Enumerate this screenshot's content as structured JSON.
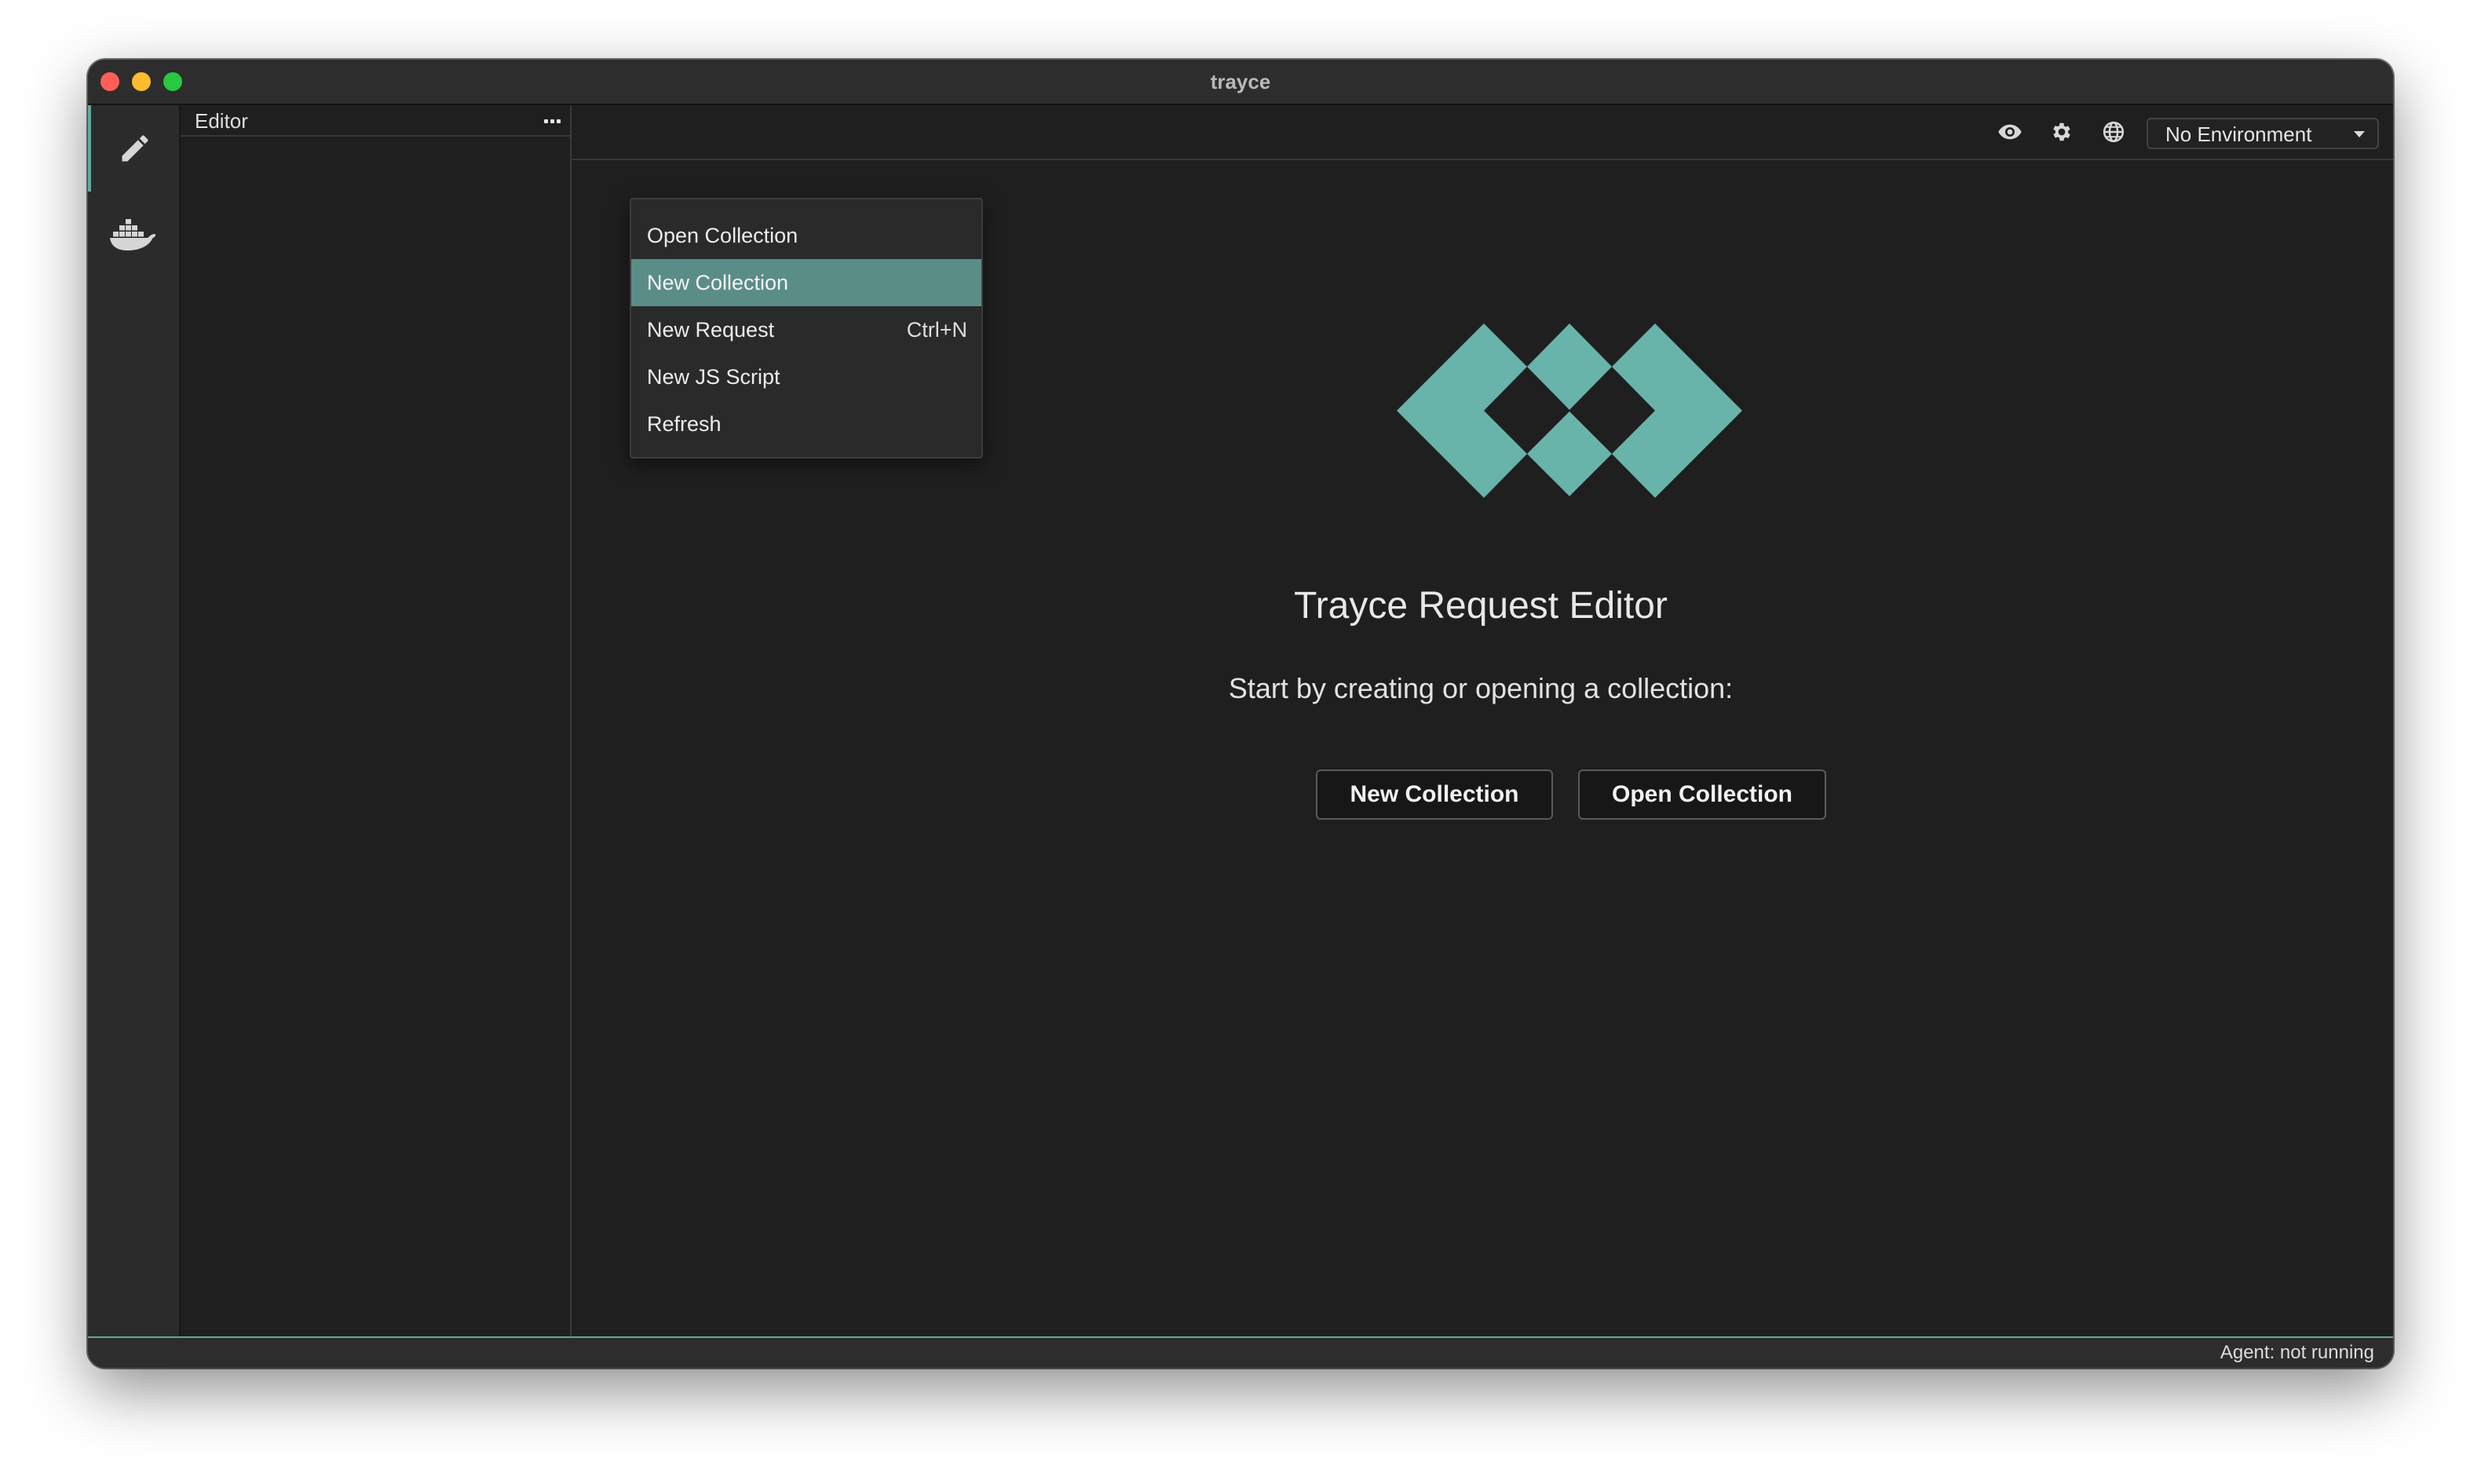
{
  "window": {
    "title": "trayce"
  },
  "activity_bar": {
    "items": [
      {
        "icon": "pencil-icon",
        "active": true
      },
      {
        "icon": "docker-whale-icon",
        "active": false
      }
    ]
  },
  "sidebar": {
    "title": "Editor",
    "more_icon": "more-horizontal-icon"
  },
  "menu": {
    "items": [
      {
        "label": "Open Collection",
        "shortcut": ""
      },
      {
        "label": "New Collection",
        "shortcut": "",
        "highlighted": true
      },
      {
        "label": "New Request",
        "shortcut": "Ctrl+N"
      },
      {
        "label": "New JS Script",
        "shortcut": ""
      },
      {
        "label": "Refresh",
        "shortcut": ""
      }
    ]
  },
  "toolbar": {
    "icons": [
      "eye-icon",
      "gear-icon",
      "globe-icon"
    ],
    "environment_select": {
      "value": "No Environment"
    }
  },
  "main": {
    "logo": "trayce-logo",
    "title": "Trayce Request Editor",
    "subtitle": "Start by creating or opening a collection:",
    "buttons": {
      "new_collection": "New Collection",
      "open_collection": "Open Collection"
    }
  },
  "statusbar": {
    "agent_status": "Agent: not running"
  },
  "colors": {
    "accent": "#62a89f",
    "menu_highlight": "#5b8d87",
    "background": "#1f1f1f"
  }
}
